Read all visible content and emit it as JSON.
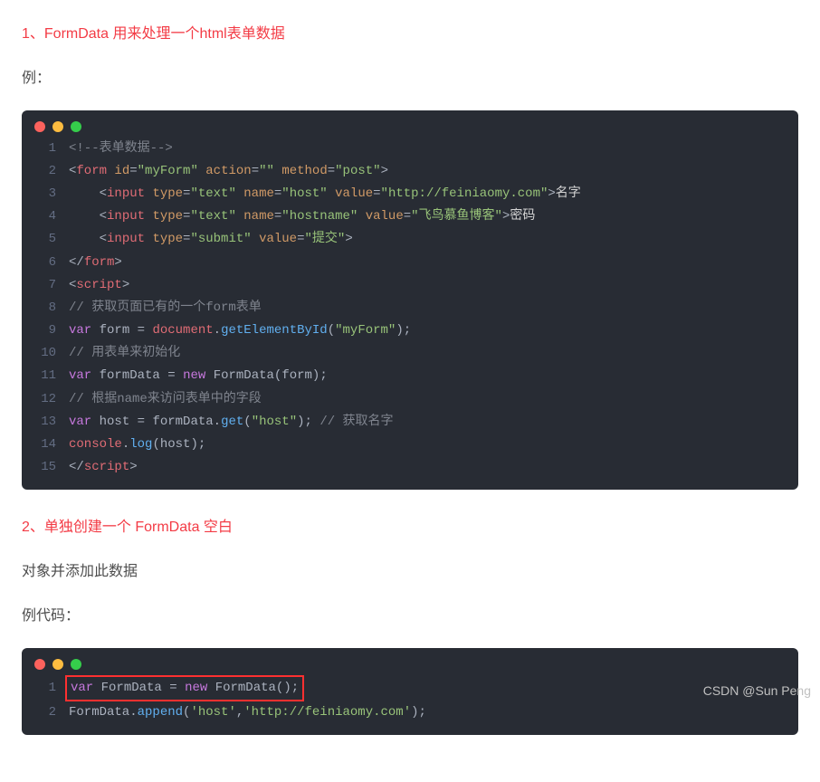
{
  "heading1": "1、FormData 用来处理一个html表单数据",
  "para1": "例：",
  "heading2": "2、单独创建一个 FormData 空白",
  "para2": "对象并添加此数据",
  "para3": "例代码：",
  "attribution": "CSDN @Sun   Peng",
  "code1": {
    "lines": {
      "1": {
        "comment_open": "<!--",
        "comment_text": "表单数据",
        "comment_close": "-->"
      },
      "2": {
        "lt": "<",
        "tag": "form",
        "sp": " ",
        "a1": "id",
        "eq": "=",
        "v1": "\"myForm\"",
        "a2": "action",
        "v2": "\"\"",
        "a3": "method",
        "v3": "\"post\"",
        "gt": ">"
      },
      "3": {
        "indent": "    ",
        "lt": "<",
        "tag": "input",
        "sp": " ",
        "a1": "type",
        "eq": "=",
        "v1": "\"text\"",
        "a2": "name",
        "v2": "\"host\"",
        "a3": "value",
        "v3": "\"http://feiniaomy.com\"",
        "gt": ">",
        "txt": "名字"
      },
      "4": {
        "indent": "    ",
        "lt": "<",
        "tag": "input",
        "sp": " ",
        "a1": "type",
        "eq": "=",
        "v1": "\"text\"",
        "a2": "name",
        "v2": "\"hostname\"",
        "a3": "value",
        "v3": "\"飞鸟慕鱼博客\"",
        "gt": ">",
        "txt": "密码"
      },
      "5": {
        "indent": "    ",
        "lt": "<",
        "tag": "input",
        "sp": " ",
        "a1": "type",
        "eq": "=",
        "v1": "\"submit\"",
        "a2": "value",
        "v2": "\"提交\"",
        "gt": ">"
      },
      "6": {
        "lt": "</",
        "tag": "form",
        "gt": ">"
      },
      "7": {
        "lt": "<",
        "tag": "script",
        "gt": ">"
      },
      "8": {
        "comment": "// 获取页面已有的一个form表单"
      },
      "9": {
        "k": "var",
        "sp": " ",
        "id1": "form",
        "eqs": " = ",
        "obj": "document",
        "dot": ".",
        "method": "getElementById",
        "paren": "(",
        "str": "\"myForm\"",
        "cparen": ")",
        "semi": ";"
      },
      "10": {
        "comment": "// 用表单来初始化"
      },
      "11": {
        "k": "var",
        "sp": " ",
        "id1": "formData",
        "eqs": " = ",
        "new": "new",
        "sp2": " ",
        "cls": "FormData",
        "paren": "(",
        "arg": "form",
        "cparen": ")",
        "semi": ";"
      },
      "12": {
        "comment": "// 根据name来访问表单中的字段"
      },
      "13": {
        "k": "var",
        "sp": " ",
        "id1": "host",
        "eqs": " = ",
        "obj": "formData",
        "dot": ".",
        "method": "get",
        "paren": "(",
        "str": "\"host\"",
        "cparen": ")",
        "semi": ";",
        "sp2": " ",
        "comment": "// 获取名字"
      },
      "14": {
        "obj": "console",
        "dot": ".",
        "method": "log",
        "paren": "(",
        "arg": "host",
        "cparen": ")",
        "semi": ";"
      },
      "15": {
        "lt": "</",
        "tag": "script",
        "gt": ">"
      }
    }
  },
  "code2": {
    "lines": {
      "1": {
        "k": "var",
        "sp": " ",
        "id1": "FormData",
        "eqs": " = ",
        "new": "new",
        "sp2": " ",
        "cls": "FormData",
        "paren": "(",
        "cparen": ")",
        "semi": ";"
      },
      "2": {
        "obj": "FormData",
        "dot": ".",
        "method": "append",
        "paren": "(",
        "s1": "'host'",
        "comma": ",",
        "s2": "'http://feiniaomy.com'",
        "cparen": ")",
        "semi": ";"
      }
    }
  }
}
